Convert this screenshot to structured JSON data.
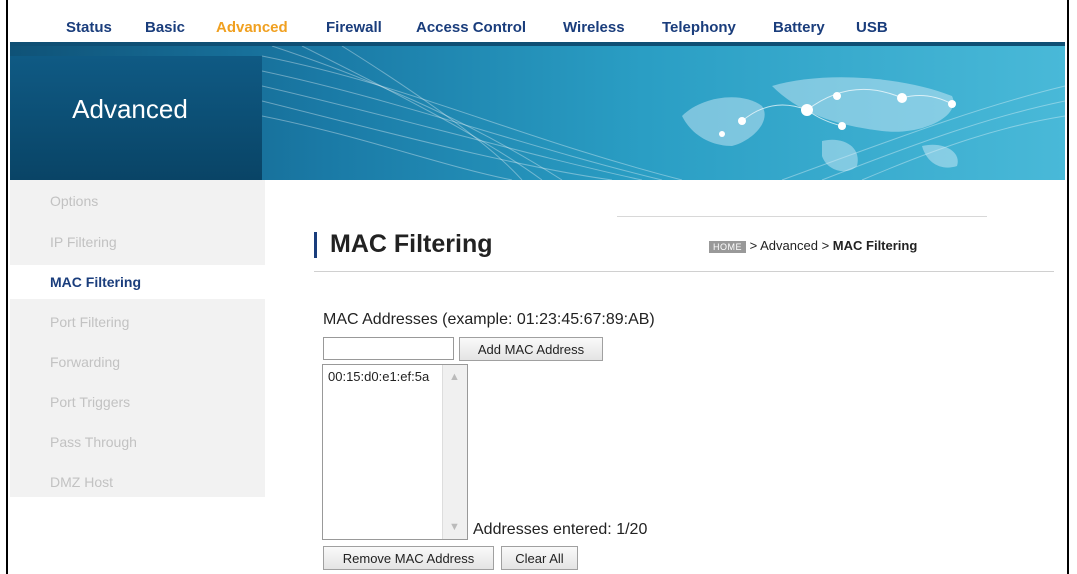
{
  "topnav": {
    "items": [
      {
        "label": "Status",
        "active": false
      },
      {
        "label": "Basic",
        "active": false
      },
      {
        "label": "Advanced",
        "active": true
      },
      {
        "label": "Firewall",
        "active": false
      },
      {
        "label": "Access Control",
        "active": false
      },
      {
        "label": "Wireless",
        "active": false
      },
      {
        "label": "Telephony",
        "active": false
      },
      {
        "label": "Battery",
        "active": false
      },
      {
        "label": "USB",
        "active": false
      }
    ]
  },
  "banner": {
    "title": "Advanced"
  },
  "sidebar": {
    "items": [
      {
        "label": "Options"
      },
      {
        "label": "IP Filtering"
      },
      {
        "label": "MAC Filtering"
      },
      {
        "label": "Port Filtering"
      },
      {
        "label": "Forwarding"
      },
      {
        "label": "Port Triggers"
      },
      {
        "label": "Pass Through"
      },
      {
        "label": "DMZ Host"
      }
    ],
    "active_label": "MAC Filtering"
  },
  "page": {
    "title": "MAC Filtering",
    "breadcrumb": {
      "home": "HOME",
      "sep": ">",
      "middle": "Advanced",
      "current": "MAC Filtering"
    }
  },
  "mac": {
    "label": "MAC Addresses (example: 01:23:45:67:89:AB)",
    "input_value": "",
    "add_button": "Add MAC Address",
    "entries": [
      "00:15:d0:e1:ef:5a"
    ],
    "count_text": "Addresses entered: 1/20",
    "remove_button": "Remove MAC Address",
    "clear_button": "Clear All"
  },
  "colors": {
    "nav_text": "#1a3d7c",
    "nav_active": "#f0a020",
    "banner_dark": "#0f5277",
    "sidebar_inactive": "#c2c2c2"
  }
}
